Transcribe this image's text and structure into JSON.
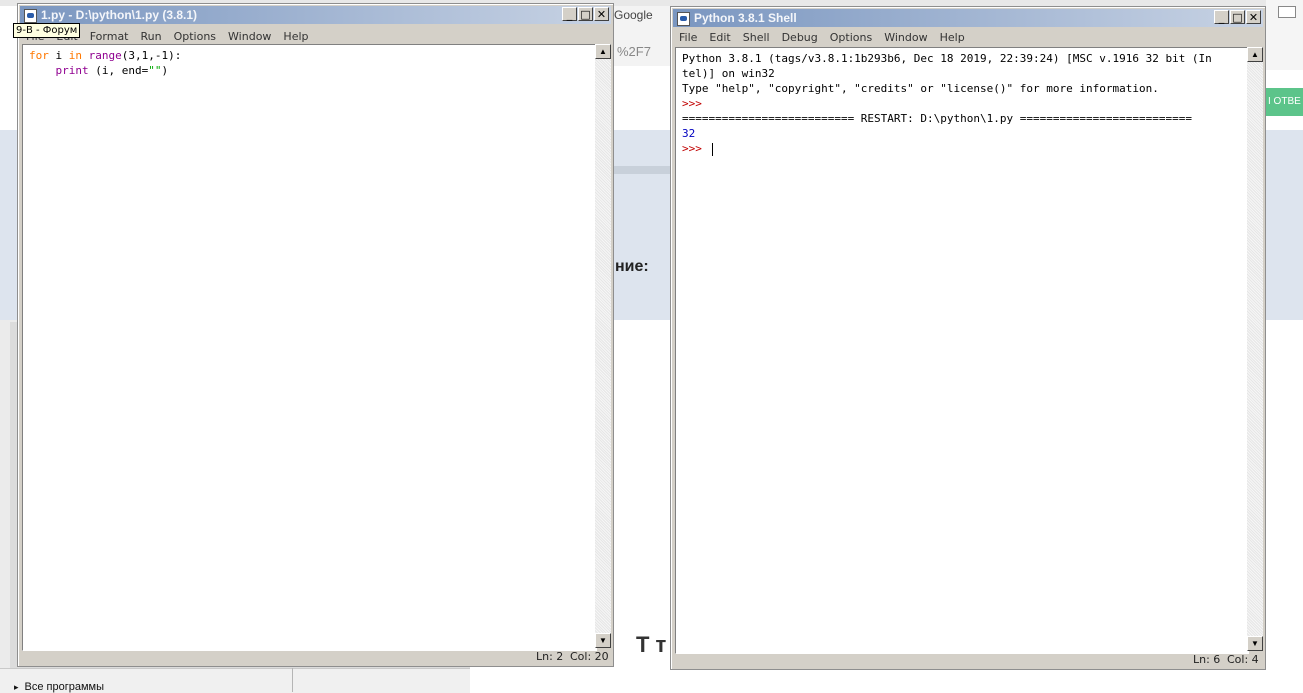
{
  "background": {
    "google_label": "Google",
    "url_fragment": "%2F7",
    "heading_fragment": "ние:",
    "big_glyph": "Т т",
    "green_button": "І ОТВЕ",
    "taskbar_all_programs": "Все программы"
  },
  "tooltip": "9-В - Форум",
  "editor": {
    "title": "1.py - D:\\python\\1.py (3.8.1)",
    "menus": [
      "File",
      "Edit",
      "Format",
      "Run",
      "Options",
      "Window",
      "Help"
    ],
    "code": [
      [
        {
          "t": "for",
          "c": "kw"
        },
        {
          "t": " i ",
          "c": "plain"
        },
        {
          "t": "in",
          "c": "kw"
        },
        {
          "t": " ",
          "c": "plain"
        },
        {
          "t": "range",
          "c": "bi"
        },
        {
          "t": "(3,1,-1):",
          "c": "plain"
        }
      ],
      [
        {
          "t": "    ",
          "c": "plain"
        },
        {
          "t": "print",
          "c": "bi"
        },
        {
          "t": " (i, end=",
          "c": "plain"
        },
        {
          "t": "\"\"",
          "c": "str"
        },
        {
          "t": ")",
          "c": "plain"
        }
      ]
    ],
    "status_ln": "Ln: 2",
    "status_col": "Col: 20"
  },
  "shell": {
    "title": "Python 3.8.1 Shell",
    "menus": [
      "File",
      "Edit",
      "Shell",
      "Debug",
      "Options",
      "Window",
      "Help"
    ],
    "lines": [
      {
        "t": "Python 3.8.1 (tags/v3.8.1:1b293b6, Dec 18 2019, 22:39:24) [MSC v.1916 32 bit (In",
        "c": "plain"
      },
      {
        "t": "tel)] on win32",
        "c": "plain"
      },
      {
        "t": "Type \"help\", \"copyright\", \"credits\" or \"license()\" for more information.",
        "c": "plain"
      },
      {
        "t": ">>>",
        "c": "prompt"
      },
      {
        "t": "========================== RESTART: D:\\python\\1.py ==========================",
        "c": "plain"
      },
      {
        "t": "32",
        "c": "out"
      },
      {
        "t": ">>> ",
        "c": "prompt",
        "cursor": true
      }
    ],
    "status_ln": "Ln: 6",
    "status_col": "Col: 4"
  },
  "colors": {
    "keyword": "#ff7700",
    "builtin": "#900090",
    "string": "#00aa00",
    "prompt": "#c00000",
    "output": "#0000c0"
  }
}
